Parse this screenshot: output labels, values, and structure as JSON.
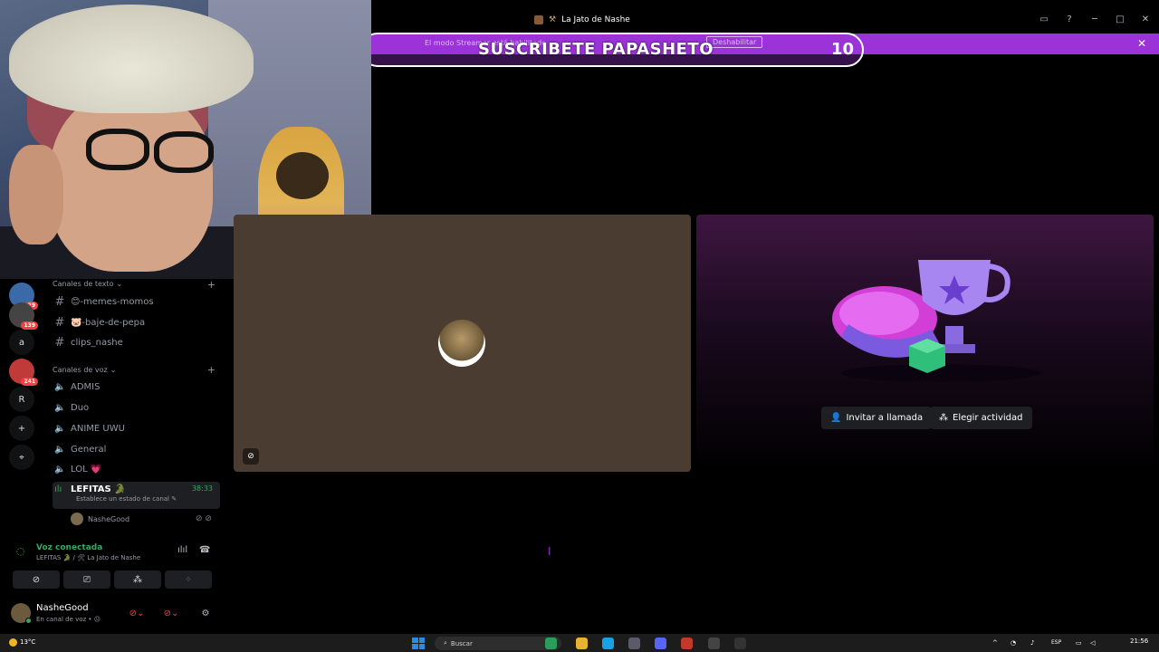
{
  "window": {
    "title": "La Jato de Nashe",
    "controls": [
      "inbox-icon",
      "help-icon",
      "minimize-icon",
      "maximize-icon",
      "close-icon"
    ]
  },
  "banner": {
    "text": "El modo Streamer está habilitado",
    "button": "Deshabilitar",
    "close": "✕"
  },
  "overlay": {
    "text": "SUSCRIBETE PAPASHETO",
    "count": "10"
  },
  "servers": [
    {
      "label": "",
      "badge": "29"
    },
    {
      "label": "",
      "badge": "139"
    },
    {
      "label": "a",
      "badge": ""
    },
    {
      "label": "",
      "badge": "241"
    },
    {
      "label": "R",
      "badge": ""
    },
    {
      "label": "+",
      "badge": ""
    },
    {
      "label": "⌖",
      "badge": ""
    }
  ],
  "channels": {
    "text_category": "Canales de texto",
    "voice_category": "Canales de voz",
    "text_channels": [
      {
        "name": "😊-memes-momos"
      },
      {
        "name": "🐷-baje-de-pepa"
      },
      {
        "name": "clips_nashe"
      }
    ],
    "voice_channels": [
      {
        "name": "ADMIS"
      },
      {
        "name": "Duo"
      },
      {
        "name": "ANIME UWU"
      },
      {
        "name": "General"
      },
      {
        "name": "LOL 💗"
      }
    ],
    "active": {
      "name": "LEFITAS 🐊",
      "time": "38:33",
      "status": "Establece un estado de canal ✎"
    },
    "voice_user": "NasheGood"
  },
  "voice_panel": {
    "title": "Voz conectada",
    "subtitle": "LEFITAS 🐊 / 🛠 La Jato de Nashe"
  },
  "user_panel": {
    "name": "NasheGood",
    "status": "En canal de voz • 😐"
  },
  "stage": {
    "invite_label": "Invitar a llamada",
    "activity_label": "Elegir actividad"
  },
  "taskbar": {
    "weather": "13°C",
    "search": "Buscar",
    "lang": "ESP",
    "time": "21:56"
  },
  "colors": {
    "accent": "#9b33d9",
    "online": "#3ba55c",
    "danger": "#f23f43"
  }
}
